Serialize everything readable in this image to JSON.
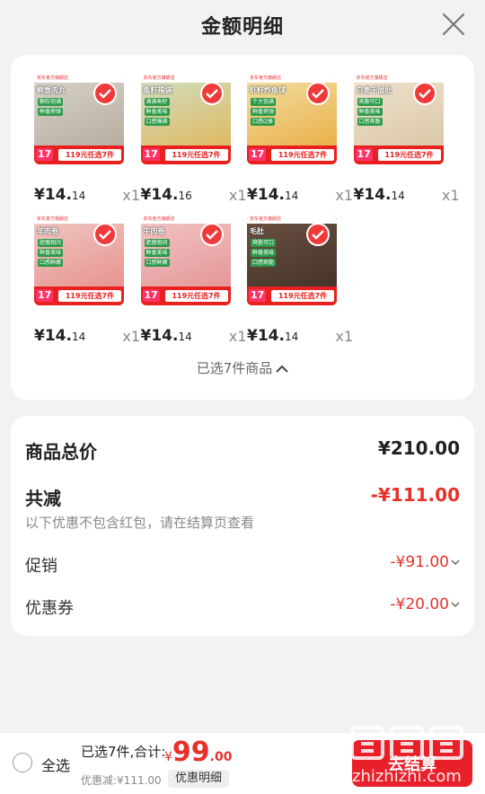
{
  "header": {
    "title": "金额明细"
  },
  "products": [
    {
      "name_tag": "鲜香肉丸",
      "features": [
        "颗粒饱满",
        "鲜香爽弹"
      ],
      "price_int": "¥14.",
      "price_dec": "14",
      "qty": "x1",
      "promo": "119元任选7件",
      "tile": "17",
      "banner": "京东官方旗舰店",
      "bg": "#d9d3c8",
      "accent": "#b1a79a"
    },
    {
      "name_tag": "鱼籽福袋",
      "features": [
        "满满鱼籽",
        "鲜香美味",
        "口感爆满"
      ],
      "price_int": "¥14.",
      "price_dec": "16",
      "qty": "x1",
      "promo": "119元任选7件",
      "tile": "17",
      "banner": "京东官方旗舰店",
      "bg": "#cfe0c6",
      "accent": "#e2b24f"
    },
    {
      "name_tag": "虾籽炸鱼球",
      "features": [
        "个大饱满",
        "鲜香爽弹",
        "口感Q弹"
      ],
      "price_int": "¥14.",
      "price_dec": "14",
      "qty": "x1",
      "promo": "119元任选7件",
      "tile": "17",
      "banner": "京东官方旗舰店",
      "bg": "#f2e0a6",
      "accent": "#e9a83a"
    },
    {
      "name_tag": "白麦千层肚",
      "features": [
        "爽脆可口",
        "鲜香美味",
        "口感爽脆"
      ],
      "price_int": "¥14.",
      "price_dec": "14",
      "qty": "x1",
      "promo": "119元任选7件",
      "tile": "17",
      "banner": "京东官方旗舰店",
      "bg": "#efe3cf",
      "accent": "#d7c3a2"
    },
    {
      "name_tag": "羊肉卷",
      "features": [
        "肥瘦相间",
        "鲜香美味",
        "口感鲜嫩"
      ],
      "price_int": "¥14.",
      "price_dec": "14",
      "qty": "x1",
      "promo": "119元任选7件",
      "tile": "17",
      "banner": "京东官方旗舰店",
      "bg": "#f0c9c4",
      "accent": "#e68a85"
    },
    {
      "name_tag": "牛肉卷",
      "features": [
        "肥瘦相间",
        "鲜香美味",
        "口感鲜嫩"
      ],
      "price_int": "¥14.",
      "price_dec": "14",
      "qty": "x1",
      "promo": "119元任选7件",
      "tile": "17",
      "banner": "京东官方旗舰店",
      "bg": "#f3c6c6",
      "accent": "#e28f90"
    },
    {
      "name_tag": "毛肚",
      "features": [
        "爽脆可口",
        "鲜香美味",
        "口感爽脆"
      ],
      "price_int": "¥14.",
      "price_dec": "14",
      "qty": "x1",
      "promo": "119元任选7件",
      "tile": "17",
      "banner": "京东官方旗舰店",
      "bg": "#6b5142",
      "accent": "#3f2e25"
    }
  ],
  "products_summary": {
    "selected_text": "已选7件商品"
  },
  "summary": {
    "total_label": "商品总价",
    "total_value": "¥210.00",
    "discount_label": "共减",
    "discount_value": "-¥111.00",
    "note": "以下优惠不包含红包，请在结算页查看",
    "promo_label": "促销",
    "promo_value": "-¥91.00",
    "coupon_label": "优惠券",
    "coupon_value": "-¥20.00"
  },
  "footer": {
    "select_all": "全选",
    "selected_total": "已选7件,合计:",
    "total_currency": "¥",
    "total_int": "99",
    "total_dec": ".00",
    "discount": "优惠减:¥111.00",
    "detail_button": "优惠明细",
    "checkout": "去结算"
  },
  "watermark": {
    "line1": "值 值 值",
    "line2": "zhizhizhi.com"
  },
  "colors": {
    "accent_red": "#e8302a",
    "checkout_red": "#e8202a",
    "check_red": "#f03a3a"
  },
  "icons": {
    "close": "close-icon",
    "check": "check-icon",
    "chevron_up": "chevron-up-icon",
    "chevron_down": "chevron-down-icon"
  }
}
